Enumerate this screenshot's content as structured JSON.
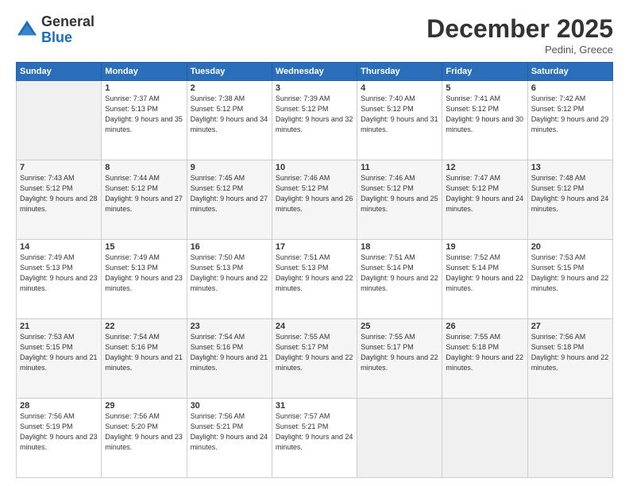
{
  "header": {
    "logo_general": "General",
    "logo_blue": "Blue",
    "month_title": "December 2025",
    "location": "Pedini, Greece"
  },
  "weekdays": [
    "Sunday",
    "Monday",
    "Tuesday",
    "Wednesday",
    "Thursday",
    "Friday",
    "Saturday"
  ],
  "weeks": [
    [
      {
        "day": "",
        "sunrise": "",
        "sunset": "",
        "daylight": ""
      },
      {
        "day": "1",
        "sunrise": "7:37 AM",
        "sunset": "5:13 PM",
        "daylight": "9 hours and 35 minutes."
      },
      {
        "day": "2",
        "sunrise": "7:38 AM",
        "sunset": "5:12 PM",
        "daylight": "9 hours and 34 minutes."
      },
      {
        "day": "3",
        "sunrise": "7:39 AM",
        "sunset": "5:12 PM",
        "daylight": "9 hours and 32 minutes."
      },
      {
        "day": "4",
        "sunrise": "7:40 AM",
        "sunset": "5:12 PM",
        "daylight": "9 hours and 31 minutes."
      },
      {
        "day": "5",
        "sunrise": "7:41 AM",
        "sunset": "5:12 PM",
        "daylight": "9 hours and 30 minutes."
      },
      {
        "day": "6",
        "sunrise": "7:42 AM",
        "sunset": "5:12 PM",
        "daylight": "9 hours and 29 minutes."
      }
    ],
    [
      {
        "day": "7",
        "sunrise": "7:43 AM",
        "sunset": "5:12 PM",
        "daylight": "9 hours and 28 minutes."
      },
      {
        "day": "8",
        "sunrise": "7:44 AM",
        "sunset": "5:12 PM",
        "daylight": "9 hours and 27 minutes."
      },
      {
        "day": "9",
        "sunrise": "7:45 AM",
        "sunset": "5:12 PM",
        "daylight": "9 hours and 27 minutes."
      },
      {
        "day": "10",
        "sunrise": "7:46 AM",
        "sunset": "5:12 PM",
        "daylight": "9 hours and 26 minutes."
      },
      {
        "day": "11",
        "sunrise": "7:46 AM",
        "sunset": "5:12 PM",
        "daylight": "9 hours and 25 minutes."
      },
      {
        "day": "12",
        "sunrise": "7:47 AM",
        "sunset": "5:12 PM",
        "daylight": "9 hours and 24 minutes."
      },
      {
        "day": "13",
        "sunrise": "7:48 AM",
        "sunset": "5:12 PM",
        "daylight": "9 hours and 24 minutes."
      }
    ],
    [
      {
        "day": "14",
        "sunrise": "7:49 AM",
        "sunset": "5:13 PM",
        "daylight": "9 hours and 23 minutes."
      },
      {
        "day": "15",
        "sunrise": "7:49 AM",
        "sunset": "5:13 PM",
        "daylight": "9 hours and 23 minutes."
      },
      {
        "day": "16",
        "sunrise": "7:50 AM",
        "sunset": "5:13 PM",
        "daylight": "9 hours and 22 minutes."
      },
      {
        "day": "17",
        "sunrise": "7:51 AM",
        "sunset": "5:13 PM",
        "daylight": "9 hours and 22 minutes."
      },
      {
        "day": "18",
        "sunrise": "7:51 AM",
        "sunset": "5:14 PM",
        "daylight": "9 hours and 22 minutes."
      },
      {
        "day": "19",
        "sunrise": "7:52 AM",
        "sunset": "5:14 PM",
        "daylight": "9 hours and 22 minutes."
      },
      {
        "day": "20",
        "sunrise": "7:53 AM",
        "sunset": "5:15 PM",
        "daylight": "9 hours and 22 minutes."
      }
    ],
    [
      {
        "day": "21",
        "sunrise": "7:53 AM",
        "sunset": "5:15 PM",
        "daylight": "9 hours and 21 minutes."
      },
      {
        "day": "22",
        "sunrise": "7:54 AM",
        "sunset": "5:16 PM",
        "daylight": "9 hours and 21 minutes."
      },
      {
        "day": "23",
        "sunrise": "7:54 AM",
        "sunset": "5:16 PM",
        "daylight": "9 hours and 21 minutes."
      },
      {
        "day": "24",
        "sunrise": "7:55 AM",
        "sunset": "5:17 PM",
        "daylight": "9 hours and 22 minutes."
      },
      {
        "day": "25",
        "sunrise": "7:55 AM",
        "sunset": "5:17 PM",
        "daylight": "9 hours and 22 minutes."
      },
      {
        "day": "26",
        "sunrise": "7:55 AM",
        "sunset": "5:18 PM",
        "daylight": "9 hours and 22 minutes."
      },
      {
        "day": "27",
        "sunrise": "7:56 AM",
        "sunset": "5:18 PM",
        "daylight": "9 hours and 22 minutes."
      }
    ],
    [
      {
        "day": "28",
        "sunrise": "7:56 AM",
        "sunset": "5:19 PM",
        "daylight": "9 hours and 23 minutes."
      },
      {
        "day": "29",
        "sunrise": "7:56 AM",
        "sunset": "5:20 PM",
        "daylight": "9 hours and 23 minutes."
      },
      {
        "day": "30",
        "sunrise": "7:56 AM",
        "sunset": "5:21 PM",
        "daylight": "9 hours and 24 minutes."
      },
      {
        "day": "31",
        "sunrise": "7:57 AM",
        "sunset": "5:21 PM",
        "daylight": "9 hours and 24 minutes."
      },
      {
        "day": "",
        "sunrise": "",
        "sunset": "",
        "daylight": ""
      },
      {
        "day": "",
        "sunrise": "",
        "sunset": "",
        "daylight": ""
      },
      {
        "day": "",
        "sunrise": "",
        "sunset": "",
        "daylight": ""
      }
    ]
  ]
}
